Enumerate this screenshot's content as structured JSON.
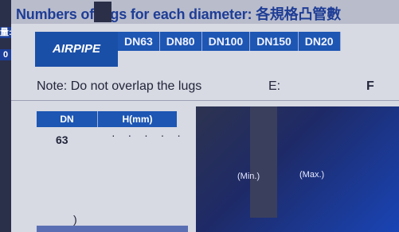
{
  "headline": "Numbers of lugs for each diameter: 各規格凸管數",
  "left_fragments": [
    "量:",
    "0"
  ],
  "brand": "AIRPIPE",
  "tabs": [
    "DN63",
    "DN80",
    "DN100",
    "DN150",
    "DN20"
  ],
  "note": "Note: Do not overlap the lugs",
  "note_e": "E:",
  "note_f": "F",
  "table": {
    "headers": [
      "DN",
      "H(mm)"
    ],
    "rows": [
      {
        "dn": "63",
        "h": "· · · · ·"
      }
    ]
  },
  "bracket_char": ")",
  "photo": {
    "min_label": "(Min.)",
    "max_label": "(Max.)"
  }
}
